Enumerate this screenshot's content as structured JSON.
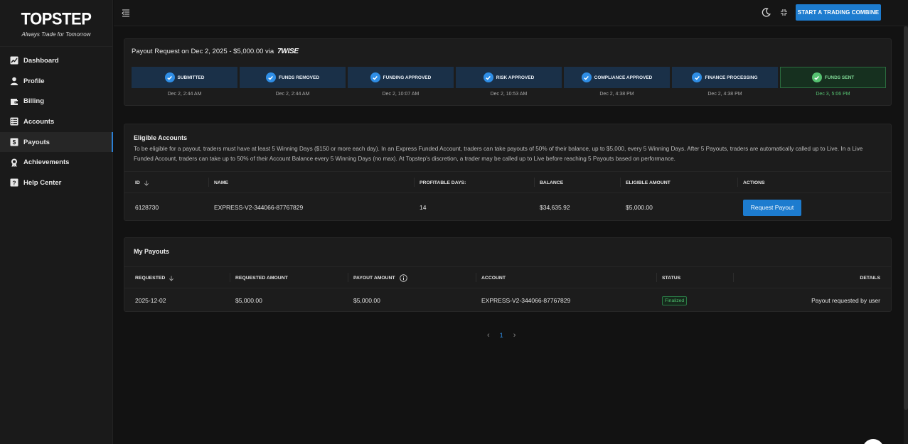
{
  "brand": {
    "logo": "TOPSTEP",
    "tagline": "Always Trade for Tomorrow"
  },
  "nav": [
    {
      "label": "Dashboard",
      "icon": "chart-line-icon"
    },
    {
      "label": "Profile",
      "icon": "user-icon"
    },
    {
      "label": "Billing",
      "icon": "wallet-icon"
    },
    {
      "label": "Accounts",
      "icon": "list-icon"
    },
    {
      "label": "Payouts",
      "icon": "dollar-icon",
      "active": true
    },
    {
      "label": "Achievements",
      "icon": "award-icon"
    },
    {
      "label": "Help Center",
      "icon": "help-icon"
    }
  ],
  "topbar": {
    "cta_label": "START A TRADING COMBINE"
  },
  "payout_request": {
    "title": "Payout Request on Dec 2, 2025 - $5,000.00 via",
    "provider": "7WISE",
    "steps": [
      {
        "label": "SUBMITTED",
        "date": "Dec 2, 2:44 AM"
      },
      {
        "label": "FUNDS REMOVED",
        "date": "Dec 2, 2:44 AM"
      },
      {
        "label": "FUNDING APPROVED",
        "date": "Dec 2, 10:07 AM"
      },
      {
        "label": "RISK APPROVED",
        "date": "Dec 2, 10:53 AM"
      },
      {
        "label": "COMPLIANCE APPROVED",
        "date": "Dec 2, 4:38 PM"
      },
      {
        "label": "FINANCE PROCESSING",
        "date": "Dec 2, 4:38 PM"
      },
      {
        "label": "FUNDS SENT",
        "date": "Dec 3, 5:06 PM"
      }
    ]
  },
  "eligible": {
    "title": "Eligible Accounts",
    "description": "To be eligible for a payout, traders must have at least 5 Winning Days ($150 or more each day). In an Express Funded Account, traders can take payouts of 50% of their balance, up to $5,000, every 5 Winning Days. After 5 Payouts, traders are automatically called up to Live. In a Live Funded Account, traders can take up to 50% of their Account Balance every 5 Winning Days (no max). At Topstep's discretion, a trader may be called up to Live before reaching 5 Payouts based on performance.",
    "columns": [
      "ID",
      "NAME",
      "PROFITABLE DAYS:",
      "BALANCE",
      "ELIGIBLE AMOUNT",
      "ACTIONS"
    ],
    "rows": [
      {
        "id": "6128730",
        "name": "EXPRESS-V2-344066-87767829",
        "profitable_days": "14",
        "balance": "$34,635.92",
        "eligible_amount": "$5,000.00",
        "action": "Request Payout"
      }
    ]
  },
  "my_payouts": {
    "title": "My Payouts",
    "columns": [
      "REQUESTED",
      "REQUESTED AMOUNT",
      "PAYOUT AMOUNT",
      "ACCOUNT",
      "STATUS",
      "DETAILS"
    ],
    "rows": [
      {
        "requested": "2025-12-02",
        "requested_amount": "$5,000.00",
        "payout_amount": "$5,000.00",
        "account": "EXPRESS-V2-344066-87767829",
        "status": "Finalized",
        "details": "Payout requested by user"
      }
    ]
  },
  "pagination": {
    "current": "1"
  },
  "colors": {
    "accent": "#1d7ccf",
    "success": "#56c271",
    "background": "#121212"
  }
}
